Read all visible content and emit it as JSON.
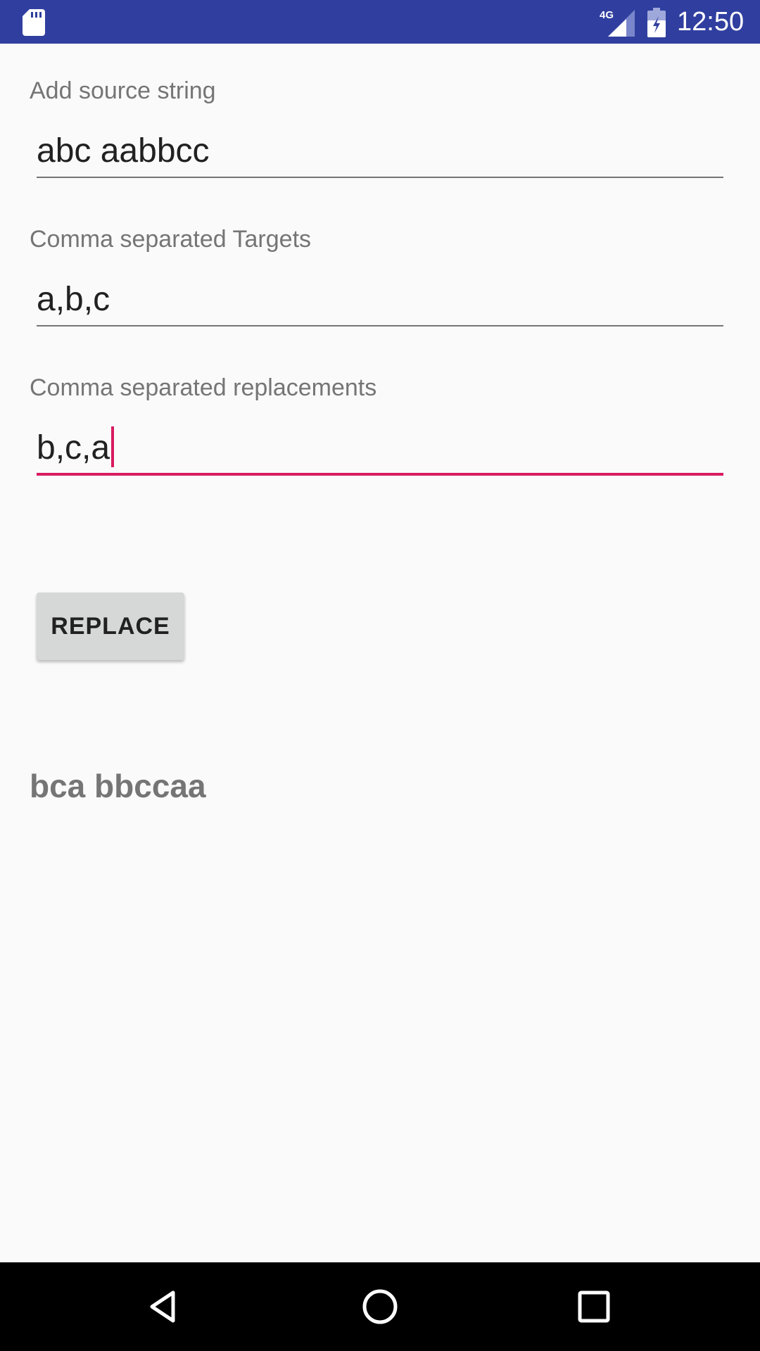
{
  "status_bar": {
    "time": "12:50",
    "network_type": "4G",
    "background_color": "#303f9f",
    "icons": [
      "sd-card-icon",
      "signal-icon",
      "battery-icon"
    ]
  },
  "form": {
    "source": {
      "label": "Add source string",
      "value": "abc aabbcc"
    },
    "targets": {
      "label": "Comma separated Targets",
      "value": "a,b,c"
    },
    "replacements": {
      "label": "Comma separated replacements",
      "value": "b,c,a",
      "focused": true
    }
  },
  "replace_button": {
    "label": "REPLACE"
  },
  "result": {
    "text": "bca bbccaa"
  },
  "nav_bar": {
    "icons": [
      "back-icon",
      "home-icon",
      "recents-icon"
    ]
  },
  "colors": {
    "accent": "#d81b60",
    "primary_dark": "#303f9f",
    "background": "#fafafa",
    "secondary_text": "#757575"
  }
}
